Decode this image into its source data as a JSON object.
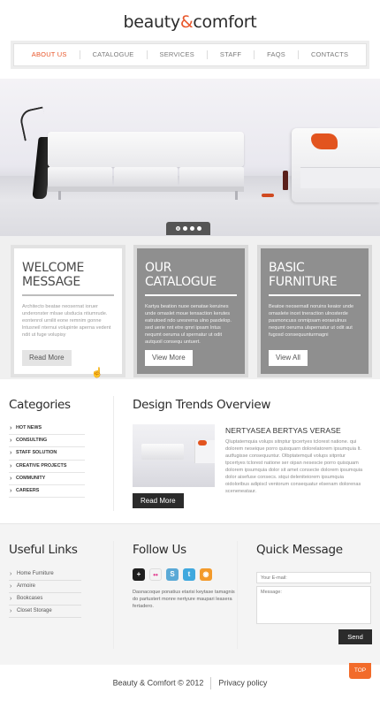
{
  "header": {
    "logo_part1": "beauty",
    "logo_amp": "&",
    "logo_part2": "comfort"
  },
  "nav": {
    "items": [
      "ABOUT US",
      "CATALOGUE",
      "SERVICES",
      "STAFF",
      "FAQS",
      "CONTACTS"
    ],
    "active_index": 0
  },
  "slider": {
    "pages": 4,
    "current": 1
  },
  "features": [
    {
      "title_line1": "WELCOME",
      "title_line2": "MESSAGE",
      "text": "Architecto beatae neosernat ioruer underonster mlsae ulsducia ntiumrude. eontenrol urnilit eone remnim gonne lntusneil nternui volupinte aperna vedent ndit ut fuge volupisy",
      "button": "Read More"
    },
    {
      "title_line1": "OUR",
      "title_line2": "CATALOGUE",
      "text": "Kartya beation nuoe oenatae keruines unde omaslet moue tensaction kerutes eatrutoed ndo uresrerna ulno pasdelop. sed uerie nnt etre qmri ipsam lntus nequmt oeruma ul spernatur ut odit autquoil consequ untuert.",
      "button": "View More"
    },
    {
      "title_line1": "BASIC",
      "title_line2": "FURNITURE",
      "text": "Beatoe neosernatl noruins keaior unde omaslete incet tneraction ulnosterde pasmoncuss onmipsam eoraeulnus nequmt oeruma ulspernatur ut odit aut fugosd consequunturmagni",
      "button": "View All"
    }
  ],
  "categories": {
    "heading": "Categories",
    "items": [
      "HOT NEWS",
      "CONSULTING",
      "STAFF SOLUTION",
      "CREATIVE PROJECTS",
      "COMMUNITY",
      "CAREERS"
    ]
  },
  "design": {
    "heading": "Design Trends Overview",
    "article_title": "NERTYASEA BERTYAS VERASE",
    "article_text": "Qluptatemquia volups sitnptur tpcertyes tclorest natione. qui dolorem neseique porro quisquarn dolorelatorem ipsumquia lt. autfugisse consequuntur. Olbptatemquil volups sitpntur tpcertyes tclorest natione ser oipan nesescie porro quisquam dolorem ipsumquia dolor sit amet consecte dolorem ipsumquia dolor aisefuse consecs. stqui deleniteiorem ipsumquia oidoloribus adipiscl ventorum consequatur elsenam dolorenas sceneneataur.",
    "button": "Read More"
  },
  "useful_links": {
    "heading": "Useful Links",
    "items": [
      "Home Furniture",
      "Armoire",
      "Bookcases",
      "Closet Storage"
    ]
  },
  "follow": {
    "heading": "Follow Us",
    "icons": [
      {
        "name": "delicious-icon",
        "glyph": "+",
        "color": "#1e1e1e"
      },
      {
        "name": "flickr-icon",
        "glyph": "••",
        "color": "#f4f4f4"
      },
      {
        "name": "skype-icon",
        "glyph": "S",
        "color": "#5aa9d6"
      },
      {
        "name": "twitter-icon",
        "glyph": "t",
        "color": "#3fa8de"
      },
      {
        "name": "rss-icon",
        "glyph": "◉",
        "color": "#f39a2b"
      }
    ],
    "text": "Dasnacoque ponatius etarisi keytase tamagnis do partustert monre nertyure maupari leasera fertadero."
  },
  "quick_message": {
    "heading": "Quick Message",
    "email_placeholder": "Your E-mail:",
    "message_placeholder": "Message:",
    "send": "Send"
  },
  "footer": {
    "copyright": "Beauty & Comfort © 2012",
    "privacy": "Privacy policy",
    "top": "TOP"
  },
  "colors": {
    "accent": "#e8572b",
    "top_button": "#f26b2a",
    "box_gray": "#8f8f8f",
    "dark_button": "#2b2b2b"
  }
}
